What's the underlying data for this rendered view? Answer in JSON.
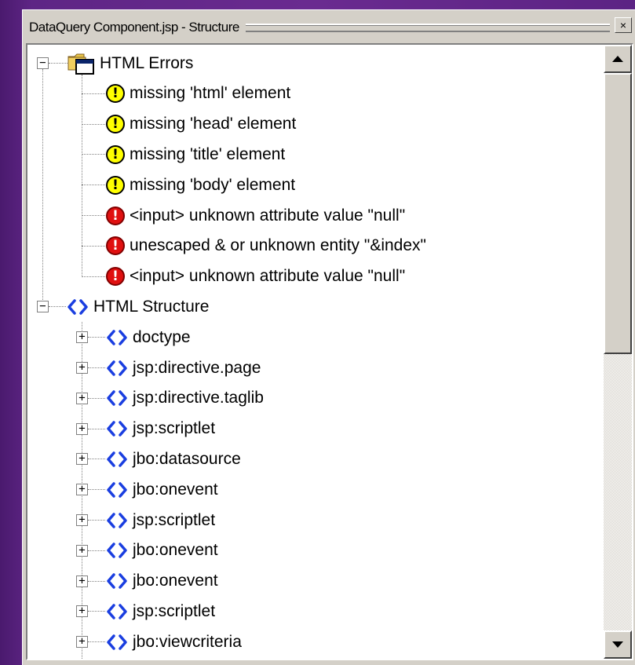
{
  "panel": {
    "title": "DataQuery Component.jsp - Structure",
    "close_glyph": "×"
  },
  "tree": {
    "errors_node": {
      "label": "HTML Errors",
      "icon": "folder-window-icon",
      "items": [
        {
          "type": "warning",
          "label": "missing 'html' element"
        },
        {
          "type": "warning",
          "label": "missing 'head' element"
        },
        {
          "type": "warning",
          "label": "missing 'title' element"
        },
        {
          "type": "warning",
          "label": "missing 'body' element"
        },
        {
          "type": "error",
          "label": "<input> unknown attribute value \"null\""
        },
        {
          "type": "error",
          "label": "unescaped & or unknown entity \"&index\""
        },
        {
          "type": "error",
          "label": "<input> unknown attribute value \"null\""
        }
      ]
    },
    "structure_node": {
      "label": "HTML Structure",
      "icon": "tag-icon",
      "items": [
        {
          "label": "doctype"
        },
        {
          "label": "jsp:directive.page"
        },
        {
          "label": "jsp:directive.taglib"
        },
        {
          "label": "jsp:scriptlet"
        },
        {
          "label": "jbo:datasource"
        },
        {
          "label": "jbo:onevent"
        },
        {
          "label": "jsp:scriptlet"
        },
        {
          "label": "jbo:onevent"
        },
        {
          "label": "jbo:onevent"
        },
        {
          "label": "jsp:scriptlet"
        },
        {
          "label": "jbo:viewcriteria"
        }
      ]
    }
  },
  "colors": {
    "warning": "#ffff00",
    "error": "#e01010",
    "tag": "#1a3ee0",
    "background": "#5e2585"
  }
}
